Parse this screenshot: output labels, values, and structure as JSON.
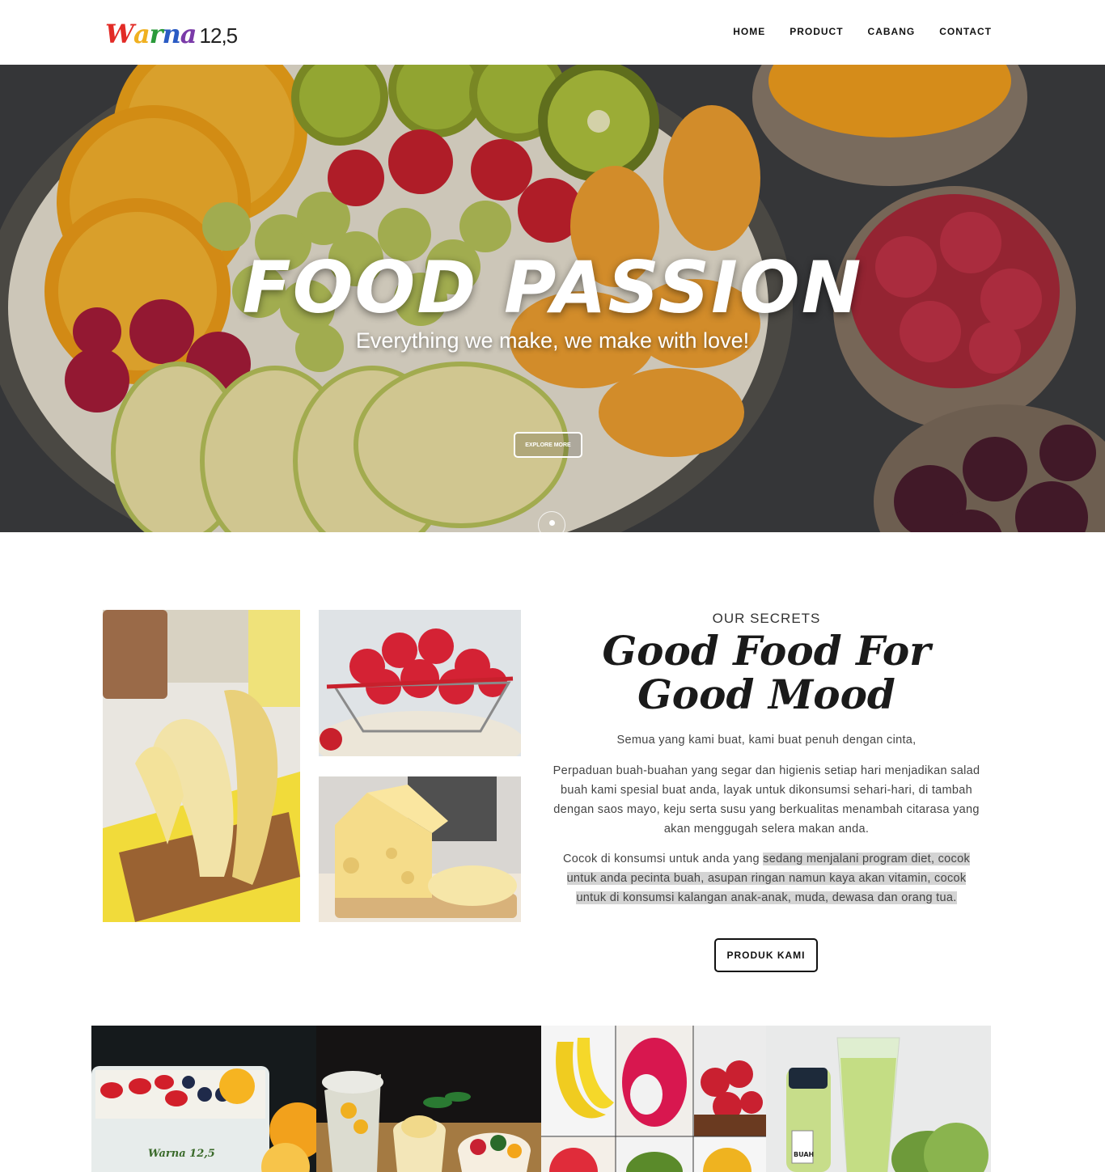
{
  "header": {
    "logo_script": "Warna",
    "logo_number": "12,5",
    "nav": [
      {
        "label": "HOME"
      },
      {
        "label": "PRODUCT"
      },
      {
        "label": "CABANG"
      },
      {
        "label": "CONTACT"
      }
    ]
  },
  "hero": {
    "title": "FOOD PASSION",
    "subtitle": "Everything we make, we make with love!",
    "button": "EXPLORE MORE"
  },
  "about": {
    "eyebrow": "OUR SECRETS",
    "title": "Good Food For Good Mood",
    "intro": "Semua yang kami buat, kami buat penuh dengan cinta,",
    "paragraph1": "Perpaduan buah-buahan yang segar dan higienis setiap hari menjadikan salad buah kami spesial buat anda, layak untuk dikonsumsi sehari-hari, di tambah dengan saos mayo, keju serta susu yang berkualitas menambah citarasa yang akan menggugah selera makan anda.",
    "paragraph2_plain": "Cocok di konsumsi untuk anda yang ",
    "paragraph2_highlight": "sedang menjalani program diet, cocok untuk anda pecinta buah, asupan ringan namun kaya akan vitamin, cocok untuk di konsumsi kalangan anak-anak, muda, dewasa dan orang tua.",
    "button": "PRODUK KAMI"
  },
  "gallery": {
    "salad_box_label": "Warna 12,5",
    "juice_label": "BUAH"
  }
}
